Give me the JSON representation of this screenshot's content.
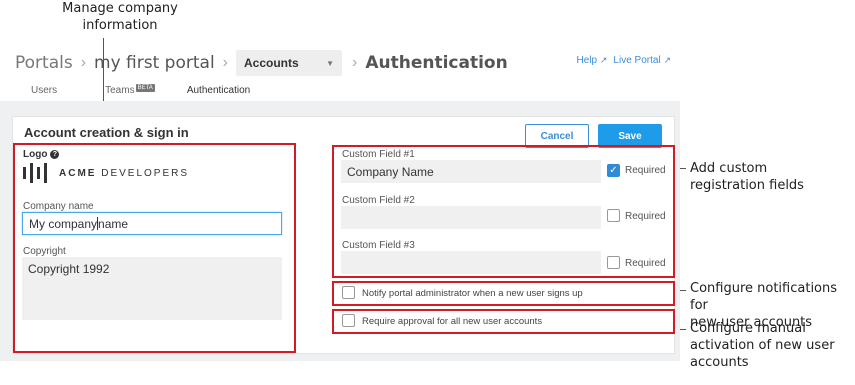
{
  "annotations": {
    "company_info": "Manage company\ninformation",
    "custom_fields": "Add custom\nregistration fields",
    "notifications": "Configure notifications for\nnew user accounts",
    "activation": "Configure manual\nactivation of new user\naccounts"
  },
  "breadcrumb": {
    "root": "Portals",
    "portal": "my first portal",
    "select_value": "Accounts",
    "current": "Authentication"
  },
  "header_links": {
    "help": "Help",
    "live_portal": "Live Portal"
  },
  "tabs": [
    {
      "label": "Users"
    },
    {
      "label": "Teams",
      "badge": "BETA"
    },
    {
      "label": "Authentication"
    }
  ],
  "card": {
    "title": "Account creation & sign in",
    "cancel_label": "Cancel",
    "save_label": "Save"
  },
  "company": {
    "logo_label": "Logo",
    "logo_brand": "ACME",
    "logo_word": "DEVELOPERS",
    "name_label": "Company name",
    "name_value_a": "My company",
    "name_value_b": "name",
    "copyright_label": "Copyright",
    "copyright_value": "Copyright 1992"
  },
  "custom_fields": [
    {
      "label": "Custom Field #1",
      "value": "Company Name",
      "required_label": "Required",
      "required": true
    },
    {
      "label": "Custom Field #2",
      "value": "",
      "required_label": "Required",
      "required": false
    },
    {
      "label": "Custom Field #3",
      "value": "",
      "required_label": "Required",
      "required": false
    }
  ],
  "options": {
    "notify_label": "Notify portal administrator when a new user signs up",
    "approval_label": "Require approval for all new user accounts"
  },
  "colors": {
    "accent": "#1e9be9",
    "annotation_red": "#d01d25",
    "link": "#3b8ddb"
  }
}
